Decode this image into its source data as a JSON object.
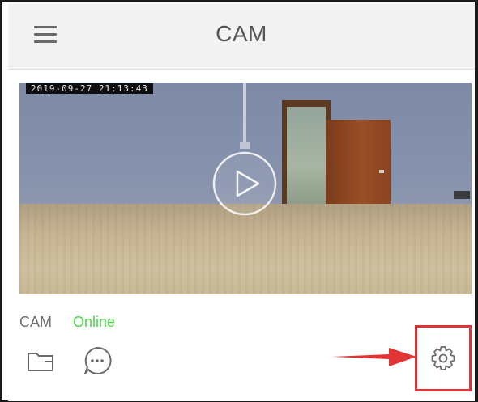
{
  "header": {
    "title": "CAM",
    "menu_icon": "hamburger-menu-icon"
  },
  "camera": {
    "name": "CAM",
    "status": "Online",
    "status_color": "#4cd94c",
    "timestamp": "2019-09-27 21:13:43"
  },
  "actions": {
    "folder_icon": "folder-icon",
    "message_icon": "chat-bubble-icon",
    "settings_icon": "gear-icon"
  },
  "annotation": {
    "color": "#e13535"
  }
}
